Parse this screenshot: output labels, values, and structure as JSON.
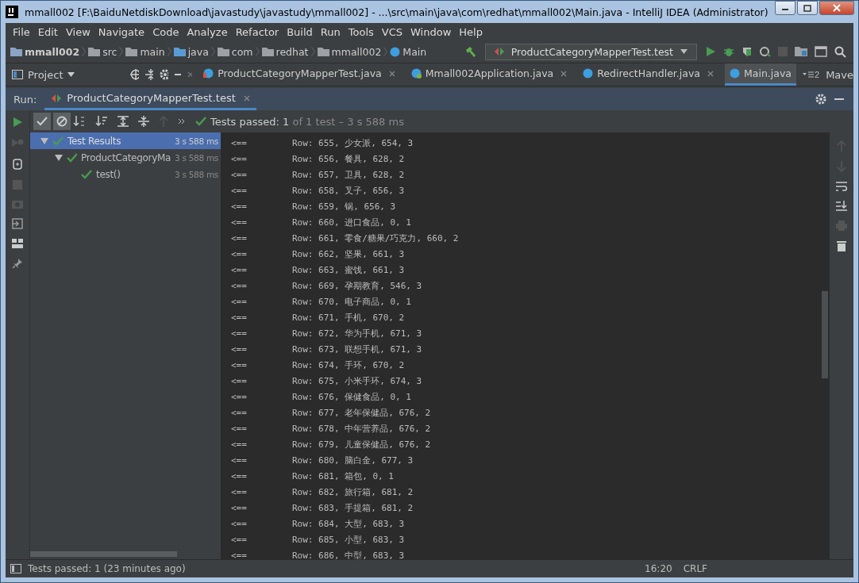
{
  "window": {
    "title": "mmall002 [F:\\BaiduNetdiskDownload\\javastudy\\javastudy\\mmall002] - ...\\src\\main\\java\\com\\redhat\\mmall002\\Main.java - IntelliJ IDEA (Administrator)"
  },
  "menu": [
    "File",
    "Edit",
    "View",
    "Navigate",
    "Code",
    "Analyze",
    "Refactor",
    "Build",
    "Run",
    "Tools",
    "VCS",
    "Window",
    "Help"
  ],
  "breadcrumbs": [
    {
      "label": "mmall002",
      "kind": "module"
    },
    {
      "label": "src",
      "kind": "folder"
    },
    {
      "label": "main",
      "kind": "folder"
    },
    {
      "label": "java",
      "kind": "source"
    },
    {
      "label": "com",
      "kind": "package"
    },
    {
      "label": "redhat",
      "kind": "package"
    },
    {
      "label": "mmall002",
      "kind": "package"
    },
    {
      "label": "Main",
      "kind": "class"
    }
  ],
  "run_config": "ProductCategoryMapperTest.test",
  "project_tab": "Project",
  "editor_tabs": [
    {
      "label": "ProductCategoryMapperTest.java",
      "kind": "test",
      "selected": false
    },
    {
      "label": "Mmall002Application.java",
      "kind": "app",
      "selected": false
    },
    {
      "label": "RedirectHandler.java",
      "kind": "class",
      "selected": false
    },
    {
      "label": "Main.java",
      "kind": "class",
      "selected": true
    }
  ],
  "tabs_overflow": "2",
  "cut_tab": "Mave",
  "run_panel": {
    "label": "Run:",
    "tab": "ProductCategoryMapperTest.test",
    "toolbar": [
      {
        "kind": "passed",
        "on": true
      },
      {
        "kind": "ignored",
        "on": true
      }
    ],
    "summary": {
      "status": "Tests passed:",
      "count": "1",
      "rest": "of 1 test – 3 s 588 ms"
    },
    "tree": [
      {
        "label": "Test Results",
        "time": "3 s 588 ms",
        "passed": true,
        "selected": true,
        "expanded": true,
        "children": [
          {
            "label": "ProductCategoryMa",
            "time": "3 s 588 ms",
            "passed": true,
            "selected": false,
            "expanded": true,
            "children": [
              {
                "label": "test()",
                "time": "3 s 588 ms",
                "passed": true,
                "selected": false
              }
            ]
          }
        ]
      }
    ],
    "console": [
      {
        "arrow": "<==",
        "text": "Row: 655, 少女派, 654, 3"
      },
      {
        "arrow": "<==",
        "text": "Row: 656, 餐具, 628, 2"
      },
      {
        "arrow": "<==",
        "text": "Row: 657, 卫具, 628, 2"
      },
      {
        "arrow": "<==",
        "text": "Row: 658, 叉子, 656, 3"
      },
      {
        "arrow": "<==",
        "text": "Row: 659, 锅, 656, 3"
      },
      {
        "arrow": "<==",
        "text": "Row: 660, 进口食品, 0, 1"
      },
      {
        "arrow": "<==",
        "text": "Row: 661, 零食/糖果/巧克力, 660, 2"
      },
      {
        "arrow": "<==",
        "text": "Row: 662, 坚果, 661, 3"
      },
      {
        "arrow": "<==",
        "text": "Row: 663, 蜜饯, 661, 3"
      },
      {
        "arrow": "<==",
        "text": "Row: 669, 孕期教育, 546, 3"
      },
      {
        "arrow": "<==",
        "text": "Row: 670, 电子商品, 0, 1"
      },
      {
        "arrow": "<==",
        "text": "Row: 671, 手机, 670, 2"
      },
      {
        "arrow": "<==",
        "text": "Row: 672, 华为手机, 671, 3"
      },
      {
        "arrow": "<==",
        "text": "Row: 673, 联想手机, 671, 3"
      },
      {
        "arrow": "<==",
        "text": "Row: 674, 手环, 670, 2"
      },
      {
        "arrow": "<==",
        "text": "Row: 675, 小米手环, 674, 3"
      },
      {
        "arrow": "<==",
        "text": "Row: 676, 保健食品, 0, 1"
      },
      {
        "arrow": "<==",
        "text": "Row: 677, 老年保健品, 676, 2"
      },
      {
        "arrow": "<==",
        "text": "Row: 678, 中年营养品, 676, 2"
      },
      {
        "arrow": "<==",
        "text": "Row: 679, 儿童保健品, 676, 2"
      },
      {
        "arrow": "<==",
        "text": "Row: 680, 脑白金, 677, 3"
      },
      {
        "arrow": "<==",
        "text": "Row: 681, 箱包, 0, 1"
      },
      {
        "arrow": "<==",
        "text": "Row: 682, 旅行箱, 681, 2"
      },
      {
        "arrow": "<==",
        "text": "Row: 683, 手提箱, 681, 2"
      },
      {
        "arrow": "<==",
        "text": "Row: 684, 大型, 683, 3"
      },
      {
        "arrow": "<==",
        "text": "Row: 685, 小型, 683, 3"
      },
      {
        "arrow": "<==",
        "text": "Row: 686, 中型, 683, 3"
      }
    ]
  },
  "status_bar": {
    "message": "Tests passed: 1 (23 minutes ago)",
    "position": "16:20",
    "line_ending": "CRLF"
  }
}
